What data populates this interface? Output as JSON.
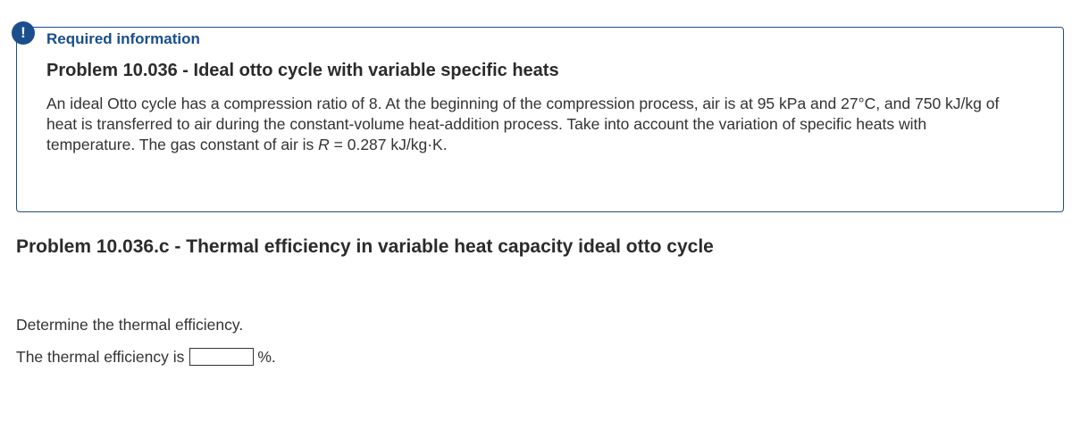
{
  "alert": {
    "icon": "exclamation-icon",
    "glyph": "!",
    "color": "#1a4e8c"
  },
  "info": {
    "required_label": "Required information",
    "problem_title": "Problem 10.036 - Ideal otto cycle with variable specific heats",
    "text_main": "An ideal Otto cycle has a compression ratio of 8. At the beginning of the compression process, air is at 95 kPa and 27°C, and 750 kJ/kg of heat is transferred to air during the constant-volume heat-addition process. Take into account the variation of specific heats with temperature. The gas constant of air is ",
    "text_var": "R",
    "text_tail": " = 0.287 kJ/kg·K."
  },
  "part": {
    "title": "Problem 10.036.c - Thermal efficiency in variable heat capacity ideal otto cycle",
    "question": "Determine the thermal efficiency.",
    "answer_prefix": "The thermal efficiency is",
    "answer_value": "",
    "answer_unit": "%."
  }
}
